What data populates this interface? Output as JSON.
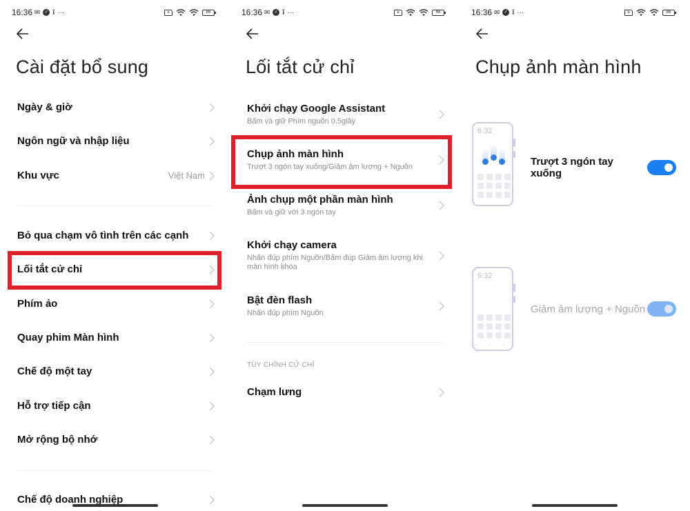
{
  "status_bar": {
    "time": "16:36",
    "left_icons": [
      "mail-icon",
      "check-circle-icon",
      "keyhole-icon",
      "more-dots-icon"
    ],
    "right_icons": [
      "sim-off-icon",
      "wifi-hotspot-icon",
      "wifi-icon",
      "battery-icon"
    ],
    "battery": "86",
    "more": "···"
  },
  "screen1": {
    "title": "Cài đặt bổ sung",
    "items": [
      {
        "label": "Ngày & giờ"
      },
      {
        "label": "Ngôn ngữ và nhập liệu"
      },
      {
        "label": "Khu vực",
        "value": "Việt Nam"
      },
      {
        "label": "Bỏ qua chạm vô tình trên các cạnh"
      },
      {
        "label": "Lối tắt cử chỉ",
        "highlighted": true
      },
      {
        "label": "Phím ảo"
      },
      {
        "label": "Quay phim Màn hình"
      },
      {
        "label": "Chế độ một tay"
      },
      {
        "label": "Hỗ trợ tiếp cận"
      },
      {
        "label": "Mở rộng bộ nhớ"
      },
      {
        "label": "Chế độ doanh nghiệp"
      }
    ]
  },
  "screen2": {
    "title": "Lối tắt cử chỉ",
    "items": [
      {
        "label": "Khởi chạy Google Assistant",
        "sub": "Bấm và giữ Phím nguồn 0.5giây"
      },
      {
        "label": "Chụp ảnh màn hình",
        "sub": "Trượt 3 ngón tay xuống/Giảm âm lượng + Nguồn",
        "highlighted": true
      },
      {
        "label": "Ảnh chụp một phần màn hình",
        "sub": "Bấm và giữ với 3 ngón tay"
      },
      {
        "label": "Khởi chạy camera",
        "sub": "Nhấn đúp phím Nguồn/Bấm đúp Giảm âm lượng khi màn hình khóa"
      },
      {
        "label": "Bật đèn flash",
        "sub": "Nhấn đúp phím Nguồn"
      }
    ],
    "section_header": "TÙY CHỈNH CỬ CHỈ",
    "custom_items": [
      {
        "label": "Chạm lưng"
      }
    ]
  },
  "screen3": {
    "title": "Chụp ảnh màn hình",
    "options": [
      {
        "label": "Trượt 3 ngón tay xuống",
        "enabled": true,
        "disabled": false,
        "illustration_clock": "6:32"
      },
      {
        "label": "Giảm âm lượng + Nguồn",
        "enabled": true,
        "disabled": true,
        "illustration_clock": "6:32"
      }
    ]
  },
  "colors": {
    "accent": "#1a7ff0",
    "highlight": "#e0202a",
    "divider": "#ececec"
  }
}
